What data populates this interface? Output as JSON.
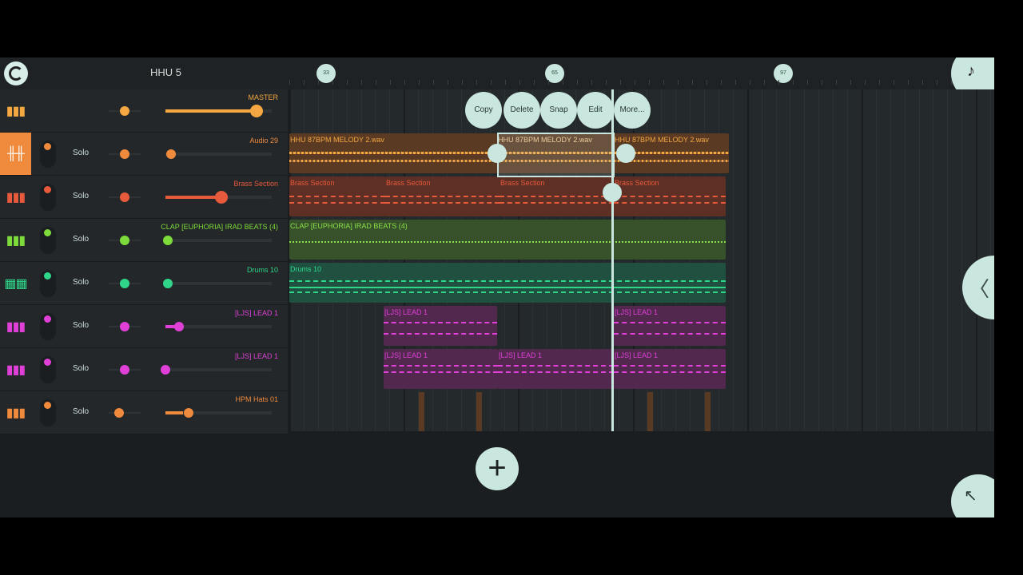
{
  "header": {
    "project_title": "HHU 5",
    "logo_icon": "fl-logo-icon",
    "corner_icon": "fruit-icon"
  },
  "ruler": {
    "markers": [
      "33",
      "65",
      "97"
    ]
  },
  "context_menu": {
    "items": [
      "Copy",
      "Delete",
      "Snap",
      "Edit",
      "More..."
    ]
  },
  "master": {
    "name": "MASTER",
    "color": "#f5a742"
  },
  "tracks": [
    {
      "name": "Audio 29",
      "solo": "Solo",
      "color": "#f08a3c",
      "icon": "waveform-icon",
      "clips": [
        {
          "label": "HHU 87BPM MELODY 2.wav"
        },
        {
          "label": "HHU 87BPM MELODY 2.wav"
        },
        {
          "label": "HHU 87BPM MELODY 2.wav"
        }
      ]
    },
    {
      "name": "Brass Section",
      "solo": "Solo",
      "color": "#e85a3c",
      "icon": "piano-icon",
      "clips": [
        {
          "label": "Brass Section"
        },
        {
          "label": "Brass Section"
        },
        {
          "label": "Brass Section"
        },
        {
          "label": "Brass Section"
        }
      ]
    },
    {
      "name": "CLAP [EUPHORIA] IRAD BEATS (4)",
      "solo": "Solo",
      "color": "#7ddc3a",
      "icon": "piano-icon",
      "clips": [
        {
          "label": "CLAP [EUPHORIA] IRAD BEATS (4)"
        }
      ]
    },
    {
      "name": "Drums 10",
      "solo": "Solo",
      "color": "#2fd68a",
      "icon": "drum-grid-icon",
      "clips": [
        {
          "label": "Drums 10"
        }
      ]
    },
    {
      "name": "[LJS] LEAD 1",
      "solo": "Solo",
      "color": "#e040d8",
      "icon": "piano-icon",
      "clips": [
        {
          "label": "[LJS] LEAD 1"
        },
        {
          "label": "[LJS] LEAD 1"
        }
      ]
    },
    {
      "name": "[LJS] LEAD 1",
      "solo": "Solo",
      "color": "#e040d8",
      "icon": "piano-icon",
      "clips": [
        {
          "label": "[LJS] LEAD 1"
        },
        {
          "label": "[LJS] LEAD 1"
        },
        {
          "label": "[LJS] LEAD 1"
        }
      ]
    },
    {
      "name": "HPM Hats 01",
      "solo": "Solo",
      "color": "#f08a3c",
      "icon": "piano-icon",
      "clips": []
    }
  ],
  "add_button_icon": "plus-icon",
  "side_button_icon": "chevron-left-icon",
  "corner_button_icon": "arrow-up-left-icon"
}
